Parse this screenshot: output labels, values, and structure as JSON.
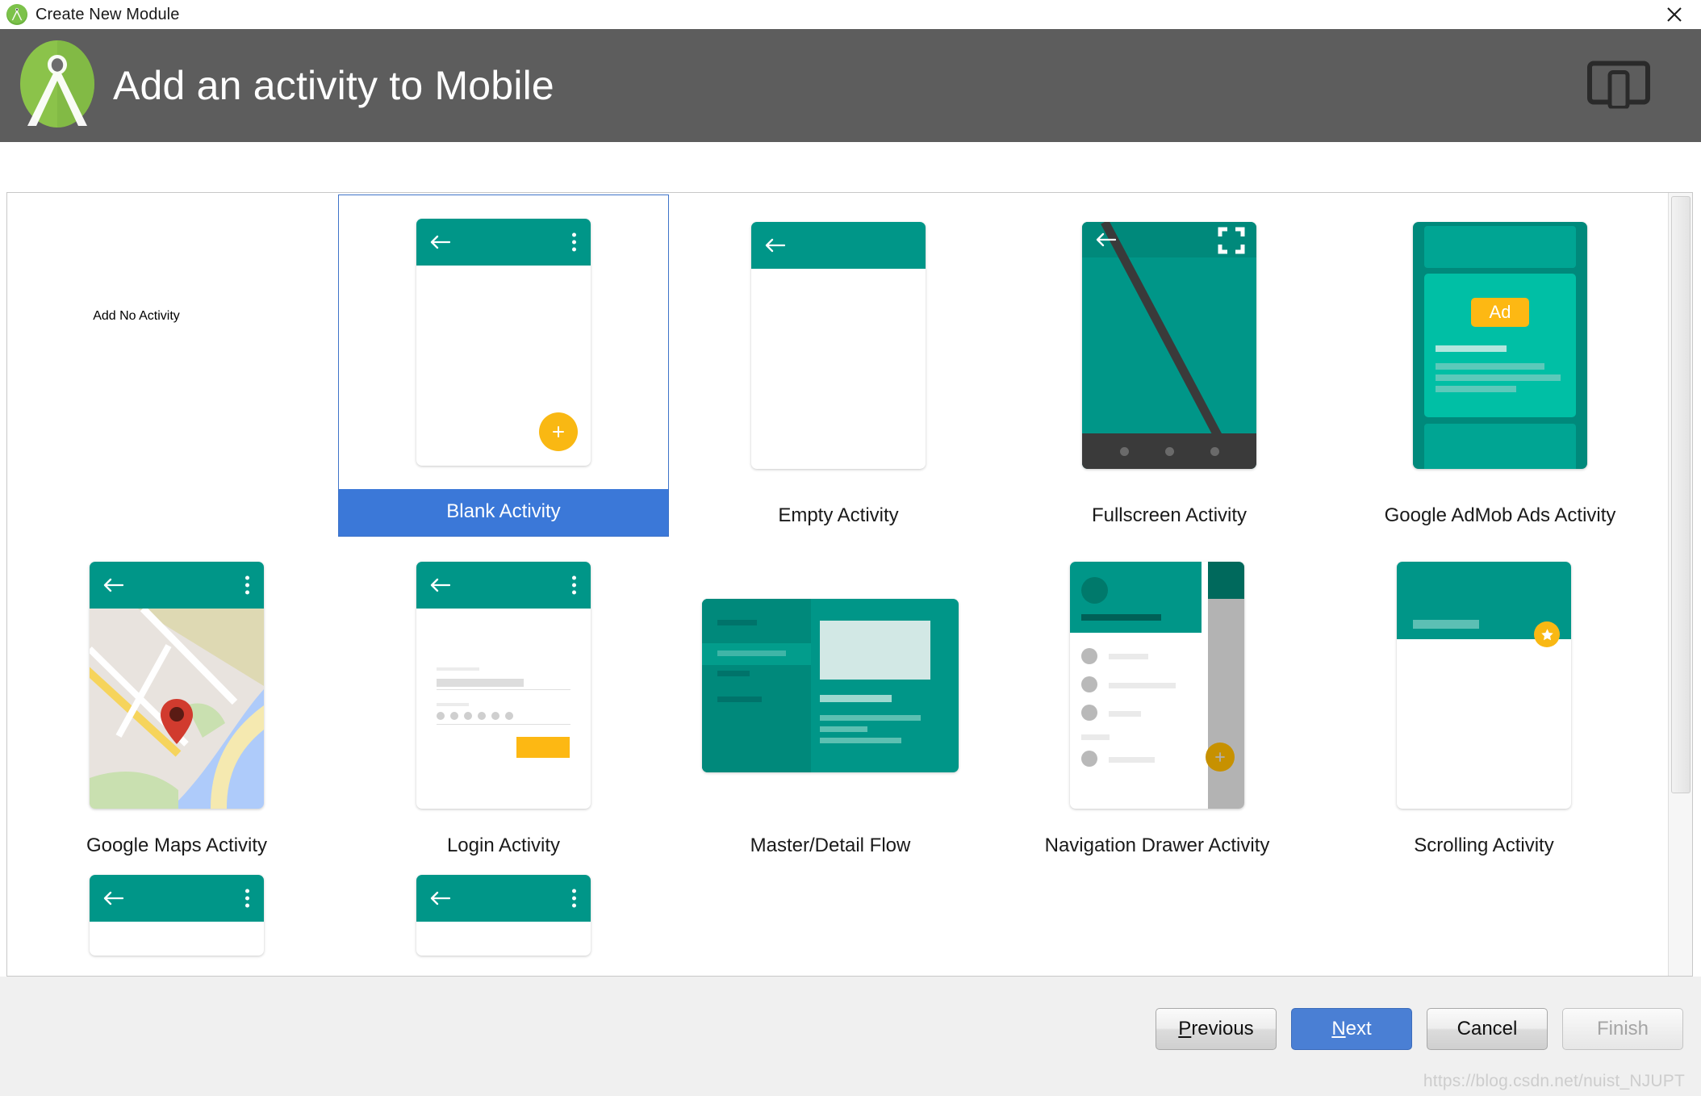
{
  "window": {
    "title": "Create New Module",
    "close_label": "×",
    "app_icon": "android-studio-icon"
  },
  "header": {
    "title": "Add an activity to Mobile",
    "logo": "android-studio-logo",
    "device_icon": "tablet-and-phone-icon",
    "background_color": "#5d5d5d"
  },
  "colors": {
    "accent_teal": "#009688",
    "accent_amber": "#f9b813",
    "selection_blue": "#3b78d8",
    "primary_button": "#4a7fd4"
  },
  "templates": [
    {
      "id": "add-no-activity",
      "label": "Add No Activity",
      "selected": false,
      "thumbnail": "none"
    },
    {
      "id": "blank-activity",
      "label": "Blank Activity",
      "selected": true,
      "thumbnail": "phone-appbar-fab"
    },
    {
      "id": "empty-activity",
      "label": "Empty Activity",
      "selected": false,
      "thumbnail": "phone-appbar-plain"
    },
    {
      "id": "fullscreen-activity",
      "label": "Fullscreen Activity",
      "selected": false,
      "thumbnail": "phone-fullscreen"
    },
    {
      "id": "google-admob-ads-activity",
      "label": "Google AdMob Ads Activity",
      "selected": false,
      "thumbnail": "phone-ad",
      "ad_badge": "Ad"
    },
    {
      "id": "google-maps-activity",
      "label": "Google Maps Activity",
      "selected": false,
      "thumbnail": "phone-map"
    },
    {
      "id": "login-activity",
      "label": "Login Activity",
      "selected": false,
      "thumbnail": "phone-login"
    },
    {
      "id": "master-detail-flow",
      "label": "Master/Detail Flow",
      "selected": false,
      "thumbnail": "tablet-master-detail"
    },
    {
      "id": "navigation-drawer-activity",
      "label": "Navigation Drawer Activity",
      "selected": false,
      "thumbnail": "phone-nav-drawer"
    },
    {
      "id": "scrolling-activity",
      "label": "Scrolling Activity",
      "selected": false,
      "thumbnail": "phone-scrolling"
    }
  ],
  "partial_row": [
    {
      "id": "partial-template-1",
      "thumbnail": "phone-appbar-plain"
    },
    {
      "id": "partial-template-2",
      "thumbnail": "phone-appbar-plain"
    }
  ],
  "footer": {
    "buttons": [
      {
        "id": "previous",
        "label": "Previous",
        "mnemonic": "P",
        "style": "default",
        "disabled": false
      },
      {
        "id": "next",
        "label": "Next",
        "mnemonic": "N",
        "style": "primary",
        "disabled": false
      },
      {
        "id": "cancel",
        "label": "Cancel",
        "mnemonic": "",
        "style": "default",
        "disabled": false
      },
      {
        "id": "finish",
        "label": "Finish",
        "mnemonic": "",
        "style": "default",
        "disabled": true
      }
    ]
  },
  "watermark": "https://blog.csdn.net/nuist_NJUPT"
}
